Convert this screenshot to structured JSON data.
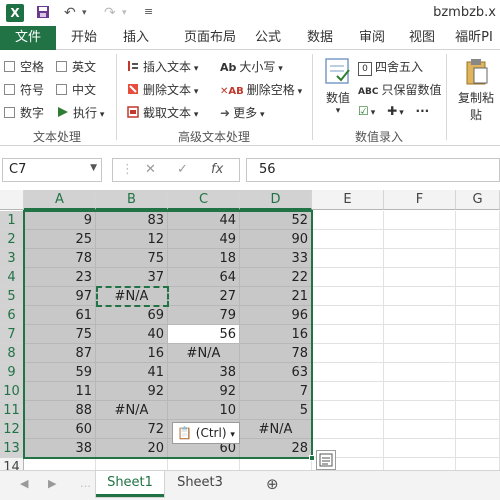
{
  "titlebar": {
    "doc_title": "bzmbzb.x"
  },
  "tabs": [
    "文件",
    "开始",
    "插入",
    "页面布局",
    "公式",
    "数据",
    "审阅",
    "视图",
    "福昕PI"
  ],
  "ribbon": {
    "checkboxes": [
      "空格",
      "英文",
      "符号",
      "中文",
      "数字"
    ],
    "exec_label": "执行",
    "group1_label": "文本处理",
    "insert_text": "插入文本",
    "delete_text": "删除文本",
    "extract_text": "截取文本",
    "upper_lower": "大小写",
    "delete_space": "删除空格",
    "more": "更多",
    "group2_label": "高级文本处理",
    "value_label": "数值",
    "round_label": "四舍五入",
    "keep_value_label": "只保留数值",
    "group3_label": "数值录入",
    "copy_paste_label": "复制粘",
    "paste_label": "贴"
  },
  "formula": {
    "cell_ref": "C7",
    "value": "56",
    "fx": "fx"
  },
  "columns": [
    "A",
    "B",
    "C",
    "D",
    "E",
    "F",
    "G"
  ],
  "rows": [
    "1",
    "2",
    "3",
    "4",
    "5",
    "6",
    "7",
    "8",
    "9",
    "10",
    "11",
    "12",
    "13",
    "14"
  ],
  "cells": [
    [
      "9",
      "83",
      "44",
      "52"
    ],
    [
      "25",
      "12",
      "49",
      "90"
    ],
    [
      "78",
      "75",
      "18",
      "33"
    ],
    [
      "23",
      "37",
      "64",
      "22"
    ],
    [
      "97",
      "#N/A",
      "27",
      "21"
    ],
    [
      "61",
      "69",
      "79",
      "96"
    ],
    [
      "75",
      "40",
      "56",
      "16"
    ],
    [
      "87",
      "16",
      "#N/A",
      "78"
    ],
    [
      "59",
      "41",
      "38",
      "63"
    ],
    [
      "11",
      "92",
      "92",
      "7"
    ],
    [
      "88",
      "#N/A",
      "10",
      "5"
    ],
    [
      "60",
      "72",
      "6",
      "#N/A"
    ],
    [
      "38",
      "20",
      "60",
      "28"
    ]
  ],
  "paste_options": "(Ctrl)",
  "sheets": [
    "Sheet1",
    "Sheet3"
  ],
  "colors": {
    "accent": "#217346",
    "selection_shade": "#c8c8c8"
  }
}
